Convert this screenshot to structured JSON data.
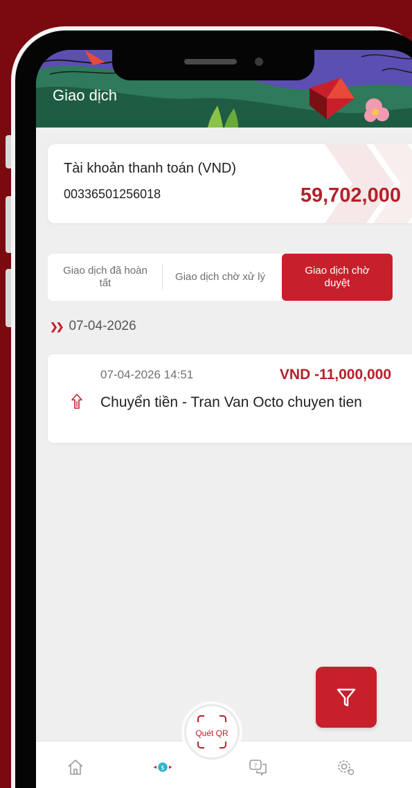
{
  "header": {
    "title": "Giao dịch"
  },
  "account": {
    "label": "Tài khoản thanh toán (VND)",
    "number": "00336501256018",
    "balance": "59,702,000"
  },
  "tabs": [
    {
      "label": "Giao dịch đã hoàn tất",
      "active": false
    },
    {
      "label": "Giao dịch chờ xử lý",
      "active": false
    },
    {
      "label": "Giao dịch chờ duyệt",
      "active": true
    }
  ],
  "date_group": {
    "date": "07-04-2026"
  },
  "transaction": {
    "time": "07-04-2026 14:51",
    "amount": "VND -11,000,000",
    "description": "Chuyển tiền - Tran Van Octo chuyen tien",
    "icon": "transfer-out-icon"
  },
  "filter": {
    "icon": "filter-icon"
  },
  "qr": {
    "label": "Quét QR"
  },
  "bottom_nav": [
    {
      "icon": "home-icon",
      "active": false
    },
    {
      "icon": "transaction-icon",
      "active": true
    },
    {
      "icon": "chat-icon",
      "active": false
    },
    {
      "icon": "settings-icon",
      "active": false
    }
  ],
  "colors": {
    "background": "#7a0a0f",
    "accent": "#c8202b",
    "balance": "#b5202a"
  }
}
